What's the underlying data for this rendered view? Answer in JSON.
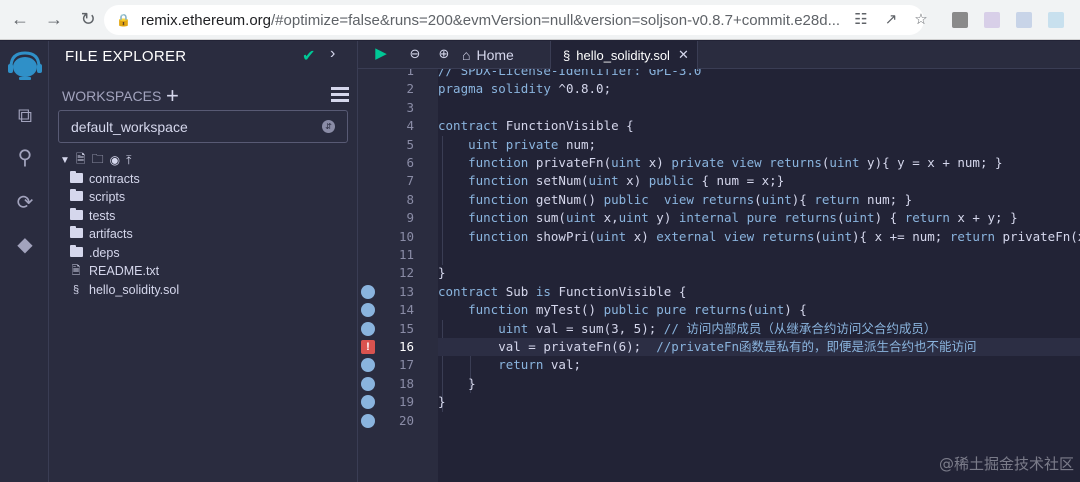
{
  "browser": {
    "url_host": "remix.ethereum.org",
    "url_path": "/#optimize=false&runs=200&evmVersion=null&version=soljson-v0.8.7+commit.e28d..."
  },
  "side_panel": {
    "title": "FILE EXPLORER",
    "workspaces_label": "WORKSPACES",
    "workspace_selected": "default_workspace",
    "tree": [
      {
        "type": "folder",
        "name": "contracts"
      },
      {
        "type": "folder",
        "name": "scripts"
      },
      {
        "type": "folder",
        "name": "tests"
      },
      {
        "type": "folder",
        "name": "artifacts"
      },
      {
        "type": "folder",
        "name": ".deps"
      },
      {
        "type": "file",
        "name": "README.txt"
      },
      {
        "type": "sol",
        "name": "hello_solidity.sol"
      }
    ]
  },
  "tabs": {
    "home_label": "Home",
    "file_label": "hello_solidity.sol"
  },
  "editor": {
    "line_numbers": [
      "1",
      "2",
      "3",
      "4",
      "5",
      "6",
      "7",
      "8",
      "9",
      "10",
      "11",
      "12",
      "13",
      "14",
      "15",
      "16",
      "17",
      "18",
      "19",
      "20"
    ],
    "lines": [
      "// SPDX-License-Identifier: GPL-3.0",
      "pragma solidity ^0.8.0;",
      "",
      "contract FunctionVisible {",
      "    uint private num;",
      "    function privateFn(uint x) private view returns(uint y){ y = x + num; }",
      "    function setNum(uint x) public { num = x;}",
      "    function getNum() public  view returns(uint){ return num; }",
      "    function sum(uint x,uint y) internal pure returns(uint) { return x + y; }",
      "    function showPri(uint x) external view returns(uint){ x += num; return privateFn(x);",
      "",
      "}",
      "contract Sub is FunctionVisible {",
      "    function myTest() public pure returns(uint) {",
      "        uint val = sum(3, 5); // 访问内部成员（从继承合约访问父合约成员）",
      "        val = privateFn(6);  //privateFn函数是私有的，即便是派生合约也不能访问",
      "        return val;",
      "    }",
      "}",
      ""
    ]
  },
  "watermark": "@稀土掘金技术社区"
}
